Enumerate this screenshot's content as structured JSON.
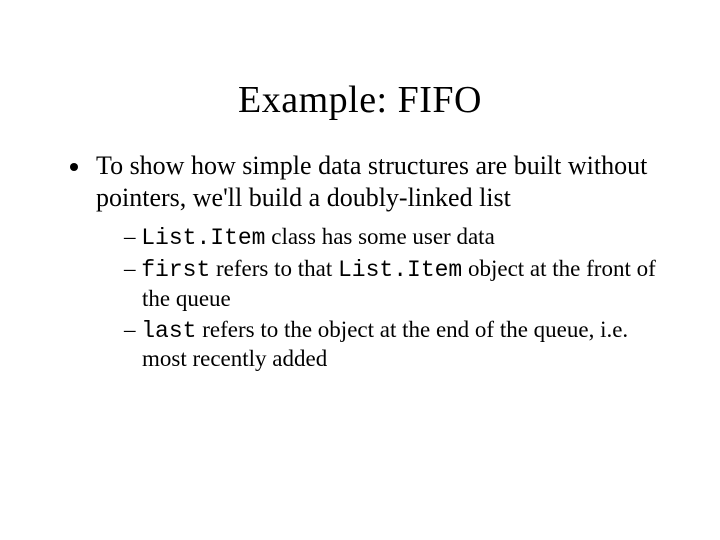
{
  "title": "Example:  FIFO",
  "bullet1": "To show how simple data structures are built without pointers, we'll build a doubly-linked list",
  "sub1": {
    "code1": "List.Item",
    "tail": " class has some user data"
  },
  "sub2": {
    "code1": "first",
    "mid": " refers to that ",
    "code2": "List.Item",
    "tail": " object at the front of the queue"
  },
  "sub3": {
    "code1": "last",
    "tail": " refers to the object at the end of the queue, i.e. most recently added"
  }
}
